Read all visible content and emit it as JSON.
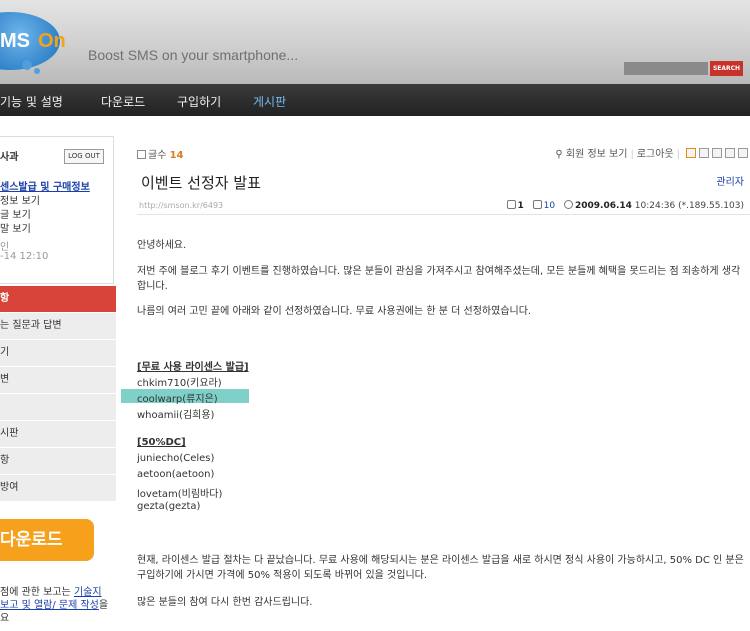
{
  "header": {
    "logo_sms": "MS",
    "logo_on": "On",
    "tagline": "Boost SMS on your smartphone...",
    "search_button": "SEARCH"
  },
  "nav": {
    "items": [
      "기능 및 설명",
      "다운로드",
      "구입하기",
      "게시판"
    ],
    "active": "게시판"
  },
  "sidebar": {
    "user": "사과",
    "logout": "LOG OUT",
    "links": [
      "센스발급 및 구매정보",
      "정보 보기",
      "글 보기",
      "말 보기"
    ],
    "status_line1": "인",
    "status_line2": "-14 12:10",
    "menu": [
      "항",
      "는 질문과 답변",
      "기",
      "변",
      "",
      "시판",
      "항",
      "방여"
    ],
    "download": "다운로드",
    "footer_text1": "점에 관한 보고는 ",
    "footer_link1": "기술지",
    "footer_link2": "보고 및 열람/ 문제 작성",
    "footer_text2": "을",
    "footer_text3": "요"
  },
  "main": {
    "post_count_label": "글수",
    "post_count": "14",
    "top_links": [
      "회원 정보 보기",
      "로그아웃"
    ],
    "title": "이벤트 선정자 발표",
    "admin": "관리자",
    "url": "http://smson.kr/6493",
    "comments": "1",
    "views": "10",
    "date": "2009.06.14",
    "time": "10:24:36 (*.189.55.103)",
    "paragraphs": [
      "안녕하세요.",
      "저번 주에 블로그 후기 이벤트를 진행하였습니다. 많은 분들이 관심을 가져주시고 참여해주셨는데, 모든 분들께 혜택을 못드리는 점 죄송하게 생각합니다.",
      "나름의 여러 고민 끝에 아래와 같이 선정하였습니다. 무료 사용권에는 한 분 더 선정하였습니다."
    ],
    "section1_title": "[무료 사용 라이센스 발급]",
    "section1": [
      "chkim710(키요라)",
      "coolwarp(류지은)",
      "whoamii(김희용)"
    ],
    "section2_title": "[50%DC]",
    "section2": [
      "juniecho(Celes)",
      "aetoon(aetoon)",
      "lovetam(비림바다)",
      "gezta(gezta)"
    ],
    "closing": [
      "현재, 라이센스 발급 절차는 다 끝났습니다. 무료 사용에 해당되시는 분은 라이센스 발급을 새로 하시면 정식 사용이 가능하시고, 50% DC 인 분은 구입하기에 가시면 가격에 50% 적용이 되도록 바뀌어 있을 것입니다.",
      "많은 분들의 참여 다시 한번 감사드립니다."
    ]
  },
  "colors": {
    "nav_active": "#77b8f0",
    "accent_orange": "#f7a01c",
    "menu_active": "#d9443a",
    "highlight": "#7fd0c9"
  }
}
